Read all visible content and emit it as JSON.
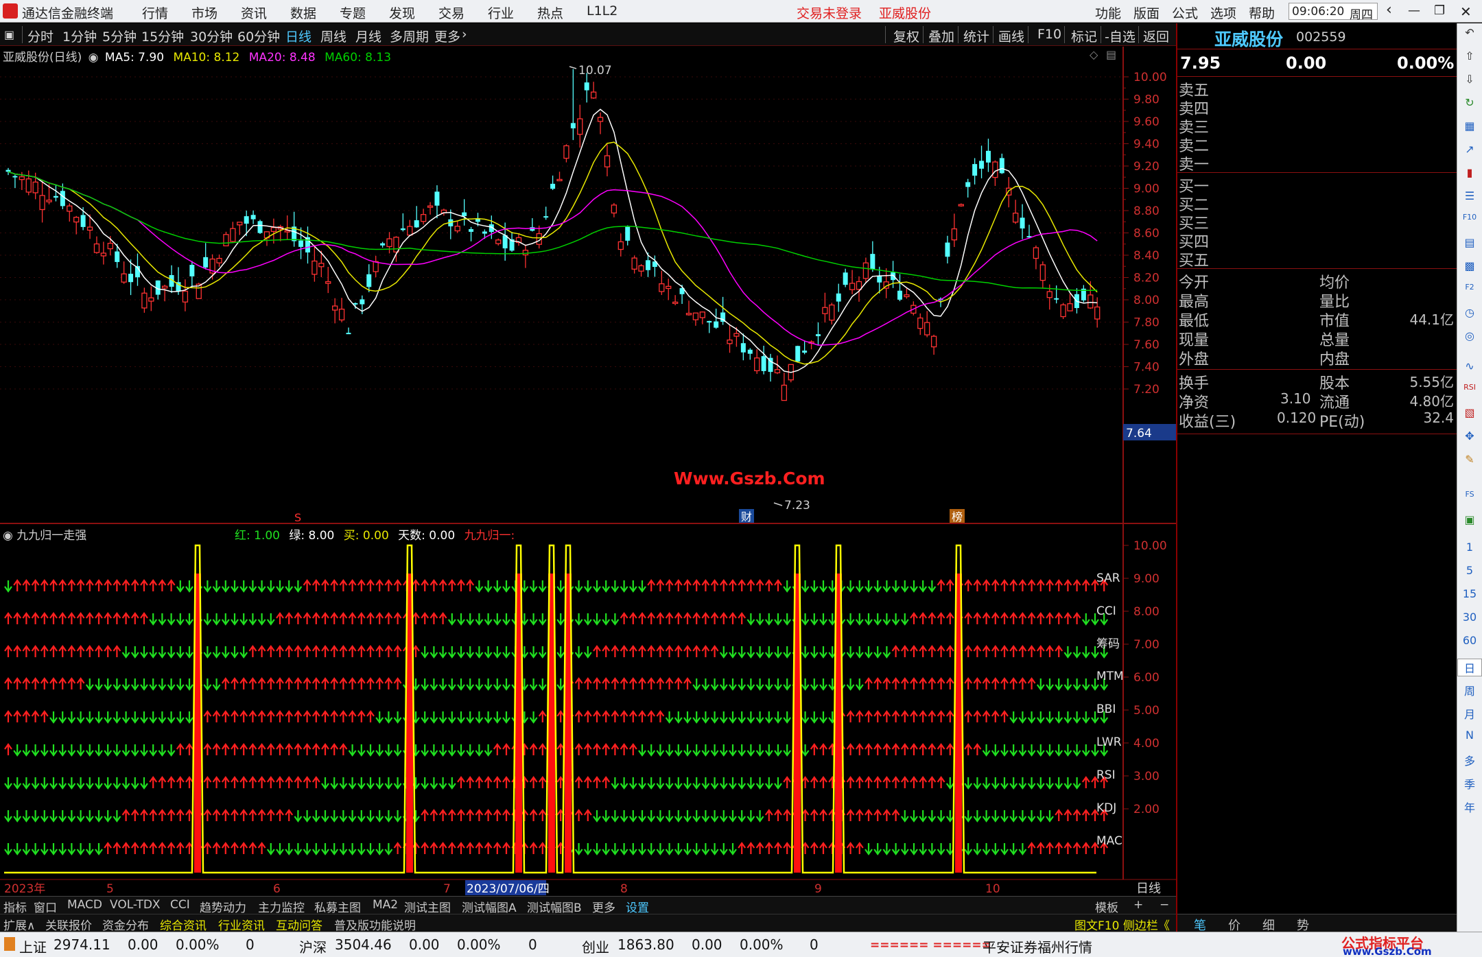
{
  "app": {
    "title": "通达信金融终端",
    "time": "09:06:20",
    "weekday": "周四"
  },
  "menu": {
    "items": [
      "行情",
      "市场",
      "资讯",
      "数据",
      "专题",
      "发现",
      "交易",
      "行业",
      "热点",
      "L1L2"
    ],
    "status_login": "交易未登录",
    "status_stock": "亚威股份",
    "right_items": [
      "功能",
      "版面",
      "公式",
      "选项",
      "帮助"
    ]
  },
  "toolbar": {
    "periods": [
      "分时",
      "1分钟",
      "5分钟",
      "15分钟",
      "30分钟",
      "60分钟",
      "日线",
      "周线",
      "月线",
      "多周期",
      "更多"
    ],
    "active_period": "日线",
    "right_buttons": [
      "复权",
      "叠加",
      "统计",
      "画线",
      "F10",
      "标记",
      "-自选",
      "返回"
    ]
  },
  "main_chart": {
    "stock_label": "亚威股份(日线)",
    "ma5": "MA5: 7.90",
    "ma10": "MA10: 8.12",
    "ma20": "MA20: 8.48",
    "ma60": "MA60: 8.13",
    "high_label": "10.07",
    "low_label": "7.23",
    "last_price_tag": "7.64",
    "watermark": "Www.Gszb.Com",
    "marker_s": "S",
    "marker_cai": "财",
    "marker_bang": "榜",
    "ticks": [
      "10.00",
      "9.80",
      "9.60",
      "9.40",
      "9.20",
      "9.00",
      "8.80",
      "8.60",
      "8.40",
      "8.20",
      "8.00",
      "7.80",
      "7.60",
      "7.40",
      "7.20"
    ]
  },
  "indicator": {
    "name": "九九归一走强",
    "red": "红: 1.00",
    "green": "绿: 8.00",
    "buy": "买: 0.00",
    "days": "天数: 0.00",
    "tag": "九九归一:",
    "rows": [
      "SAR",
      "CCI",
      "筹码",
      "MTM",
      "BBI",
      "LWR",
      "RSI",
      "KDJ",
      "MAC"
    ],
    "ticks": [
      "10.00",
      "9.00",
      "8.00",
      "7.00",
      "6.00",
      "5.00",
      "4.00",
      "3.00",
      "2.00"
    ]
  },
  "date_axis": {
    "year": "2023年",
    "m5": "5",
    "m6": "6",
    "m7": "7",
    "highlight": "2023/07/06/四",
    "m8": "8",
    "m9": "9",
    "m10": "10",
    "period": "日线"
  },
  "tabs1": {
    "items": [
      "指标",
      "窗口",
      "MACD",
      "VOL-TDX",
      "CCI",
      "趋势动力",
      "主力监控",
      "私募主图",
      "MA2",
      "测试主图",
      "测试幅图A",
      "测试幅图B",
      "更多",
      "设置"
    ],
    "template": "模板",
    "plus": "+",
    "minus": "−"
  },
  "tabs2": {
    "items": [
      "扩展∧",
      "关联报价",
      "资金分布",
      "综合资讯",
      "行业资讯",
      "互动问答",
      "普及版功能说明"
    ],
    "right": "图文F10 侧边栏《"
  },
  "quote": {
    "name": "亚威股份",
    "code": "002559",
    "price": "7.95",
    "change": "0.00",
    "pct": "0.00%",
    "sell": [
      "卖五",
      "卖四",
      "卖三",
      "卖二",
      "卖一"
    ],
    "buy": [
      "买一",
      "买二",
      "买三",
      "买四",
      "买五"
    ],
    "stats_left": [
      "今开",
      "最高",
      "最低",
      "现量",
      "外盘"
    ],
    "stats_right": [
      "均价",
      "量比",
      "市值",
      "总量",
      "内盘"
    ],
    "mktcap": "44.1亿",
    "fin": [
      [
        "换手",
        "",
        "股本",
        "5.55亿"
      ],
      [
        "净资",
        "3.10",
        "流通",
        "4.80亿"
      ],
      [
        "收益(三)",
        "0.120",
        "PE(动)",
        "32.4"
      ]
    ],
    "tabs": [
      "笔",
      "价",
      "细",
      "势"
    ]
  },
  "vtool": {
    "labels": [
      "1",
      "5",
      "15",
      "30",
      "60",
      "日",
      "周",
      "月",
      "N",
      "多",
      "季",
      "年"
    ]
  },
  "status": {
    "sh_name": "上证",
    "sh_val": "2974.11",
    "sh_chg": "0.00",
    "sh_pct": "0.00%",
    "sh_vol": "0",
    "hs_name": "沪深",
    "hs_val": "3504.46",
    "hs_chg": "0.00",
    "hs_pct": "0.00%",
    "hs_vol": "0",
    "cy_name": "创业",
    "cy_val": "1863.80",
    "cy_chg": "0.00",
    "cy_pct": "0.00%",
    "cy_vol": "0",
    "bars": "====== ======",
    "broker": "平安证券福州行情",
    "brand1": "公式指标平台",
    "brand2": "www.Gszb.Com"
  },
  "colors": {
    "up": "#ff3232",
    "down": "#54ffff",
    "ma5": "#ffffff",
    "ma10": "#e8e800",
    "ma20": "#ff00ff",
    "ma60": "#00d000",
    "arrow_up": "#ff2020",
    "arrow_down": "#20e020",
    "bar_yellow": "#ffff00"
  }
}
